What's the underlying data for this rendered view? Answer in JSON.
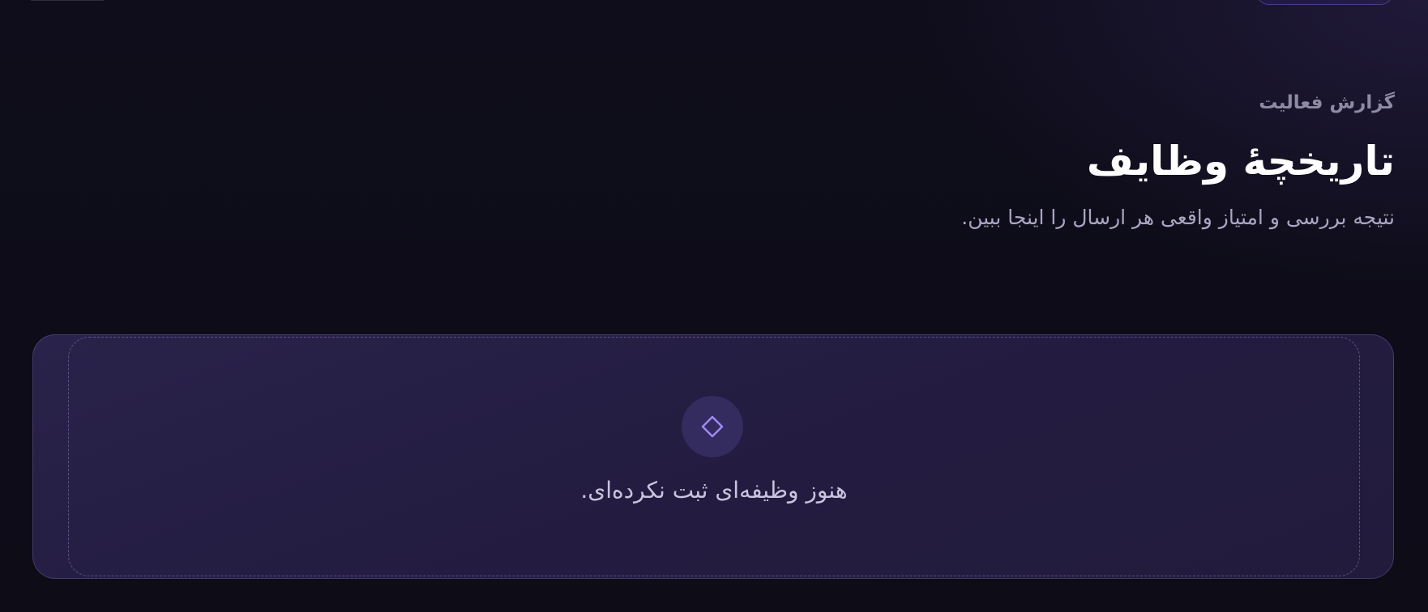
{
  "header": {
    "eyebrow": "گزارش فعالیت",
    "title": "تاریخچهٔ وظایف",
    "subtitle": "نتیجه بررسی و امتیاز واقعی هر ارسال را اینجا ببین."
  },
  "empty_state": {
    "icon": "diamond-icon",
    "message": "هنوز وظیفه‌ای ثبت نکرده‌ای."
  },
  "colors": {
    "background": "#0e0c19",
    "card": "#261f45",
    "accent": "#9f86f2",
    "muted_text": "#8e8aa6"
  }
}
